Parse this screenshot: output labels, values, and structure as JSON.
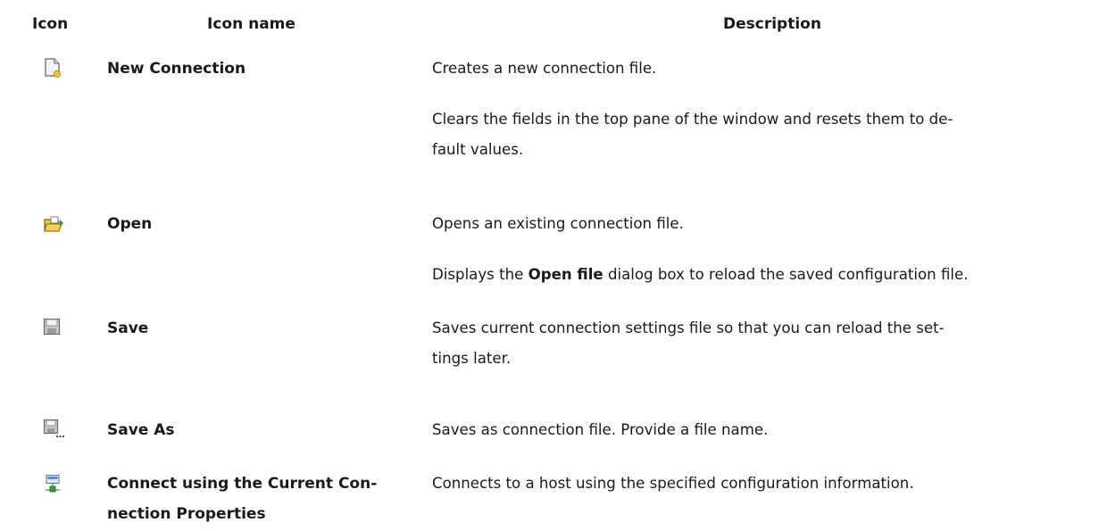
{
  "table": {
    "headers": {
      "icon": "Icon",
      "name": "Icon name",
      "description": "Description"
    },
    "rows": [
      {
        "icon": "new-connection-icon",
        "name": "New Connection",
        "desc": [
          "Creates a new connection file.",
          "Clears the fields in the top pane of the window and resets them to de-",
          "fault values."
        ]
      },
      {
        "icon": "open-folder-icon",
        "name": "Open",
        "desc": [
          "Opens an existing connection file.",
          "Displays the ",
          "Open file",
          " dialog box to reload the saved configuration file."
        ]
      },
      {
        "icon": "save-icon",
        "name": "Save",
        "desc": [
          "Saves current connection settings file so that you can reload the set-",
          "tings later."
        ]
      },
      {
        "icon": "save-as-icon",
        "name": "Save As",
        "desc": [
          "Saves as connection file. Provide a file name."
        ]
      },
      {
        "icon": "connect-icon",
        "name_lines": [
          "Connect using the Current Con-",
          "nection Properties"
        ],
        "desc": [
          "Connects to a host using the specified configuration information."
        ]
      }
    ]
  },
  "colors": {
    "text": "#1a1a1a",
    "icon_yellow": "#e8c840",
    "icon_gray": "#8a8a8a",
    "icon_green": "#3a9a3a",
    "icon_blue": "#5a8ac8"
  }
}
